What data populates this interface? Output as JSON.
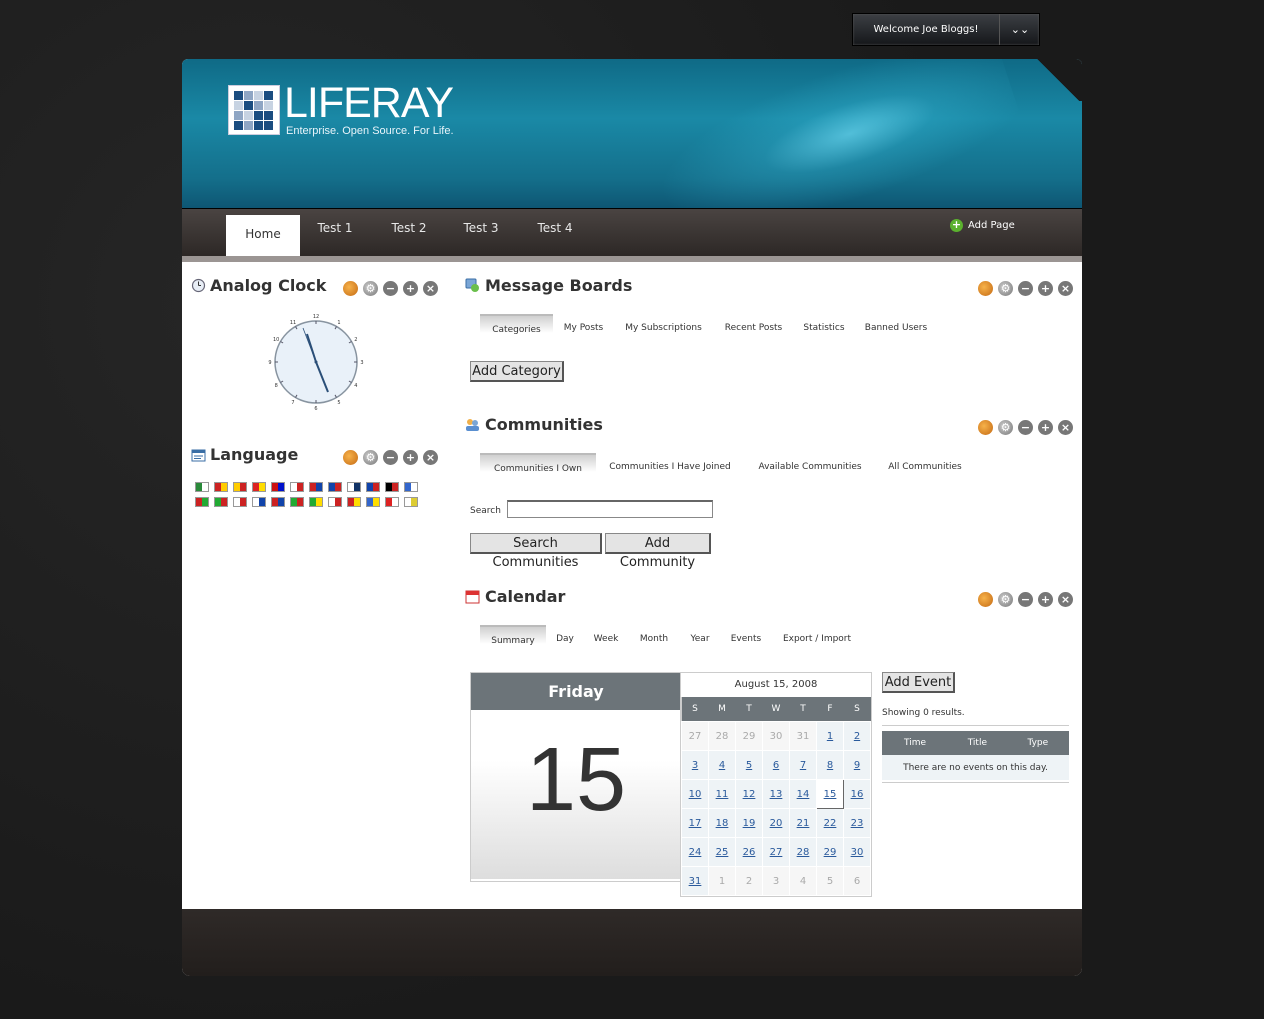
{
  "dock": {
    "welcome": "Welcome Joe Bloggs!",
    "menu_icon": "double-chevron-down-icon"
  },
  "brand": {
    "logo_text": "LIFERAY",
    "tagline": "Enterprise. Open Source. For Life."
  },
  "nav": {
    "tabs": [
      {
        "label": "Home",
        "active": true
      },
      {
        "label": "Test 1"
      },
      {
        "label": "Test 2"
      },
      {
        "label": "Test 3"
      },
      {
        "label": "Test 4"
      }
    ],
    "add_page": "Add Page"
  },
  "portlets": {
    "clock": {
      "title": "Analog Clock",
      "hour_labels": [
        "12",
        "1",
        "2",
        "3",
        "4",
        "5",
        "6",
        "7",
        "8",
        "9",
        "10",
        "11"
      ]
    },
    "language": {
      "title": "Language",
      "flags": [
        "ar",
        "ca",
        "ca-ES",
        "zh-CN",
        "zh-TW",
        "cs",
        "nl",
        "en",
        "fi",
        "fr",
        "de",
        "el",
        "hu",
        "it",
        "ja",
        "ko",
        "nb",
        "fa",
        "pt",
        "ru",
        "es",
        "sv",
        "tr",
        "vi"
      ]
    },
    "message_boards": {
      "title": "Message Boards",
      "tabs": [
        "Categories",
        "My Posts",
        "My Subscriptions",
        "Recent Posts",
        "Statistics",
        "Banned Users"
      ],
      "add_category": "Add Category"
    },
    "communities": {
      "title": "Communities",
      "tabs": [
        "Communities I Own",
        "Communities I Have Joined",
        "Available Communities",
        "All Communities"
      ],
      "search_label": "Search",
      "search_value": "",
      "search_button": "Search Communities",
      "add_button": "Add Community"
    },
    "calendar": {
      "title": "Calendar",
      "tabs": [
        "Summary",
        "Day",
        "Week",
        "Month",
        "Year",
        "Events",
        "Export / Import"
      ],
      "day_name": "Friday",
      "day_number": "15",
      "month_header": "August 15, 2008",
      "weekdays": [
        "S",
        "M",
        "T",
        "W",
        "T",
        "F",
        "S"
      ],
      "weeks": [
        [
          "27",
          "28",
          "29",
          "30",
          "31",
          "1",
          "2"
        ],
        [
          "3",
          "4",
          "5",
          "6",
          "7",
          "8",
          "9"
        ],
        [
          "10",
          "11",
          "12",
          "13",
          "14",
          "15",
          "16"
        ],
        [
          "17",
          "18",
          "19",
          "20",
          "21",
          "22",
          "23"
        ],
        [
          "24",
          "25",
          "26",
          "27",
          "28",
          "29",
          "30"
        ],
        [
          "31",
          "1",
          "2",
          "3",
          "4",
          "5",
          "6"
        ]
      ],
      "add_event": "Add Event",
      "results": "Showing 0 results.",
      "columns": [
        "Time",
        "Title",
        "Type"
      ],
      "empty": "There are no events on this day."
    }
  },
  "controls": {
    "look_feel": "palette-icon",
    "configure": "gear-icon",
    "minimize": "minus-icon",
    "maximize": "plus-icon",
    "close": "close-icon"
  }
}
